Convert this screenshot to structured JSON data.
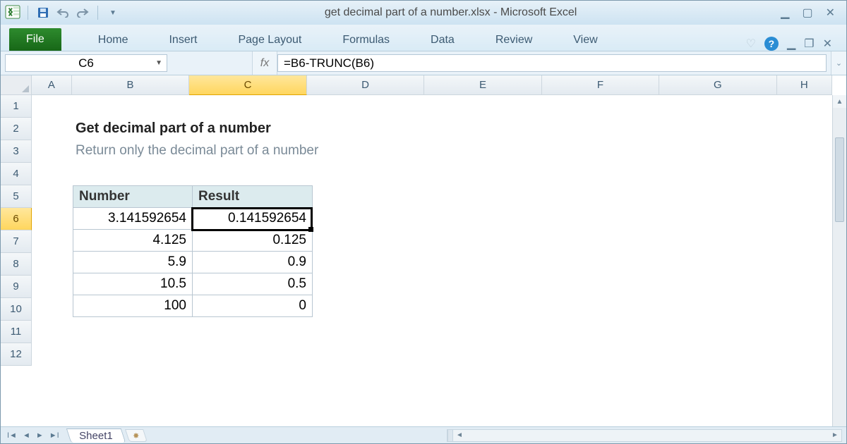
{
  "title": "get decimal part of a number.xlsx  -  Microsoft Excel",
  "ribbon": {
    "file": "File",
    "tabs": [
      "Home",
      "Insert",
      "Page Layout",
      "Formulas",
      "Data",
      "Review",
      "View"
    ]
  },
  "namebox": "C6",
  "fx_symbol": "fx",
  "formula": "=B6-TRUNC(B6)",
  "columns": [
    "A",
    "B",
    "C",
    "D",
    "E",
    "F",
    "G",
    "H"
  ],
  "rows": [
    "1",
    "2",
    "3",
    "4",
    "5",
    "6",
    "7",
    "8",
    "9",
    "10",
    "11",
    "12"
  ],
  "selected_col": "C",
  "selected_row": "6",
  "content": {
    "title": "Get decimal part of a number",
    "subtitle": "Return only the decimal part of a number",
    "headers": {
      "b": "Number",
      "c": "Result"
    },
    "data": [
      {
        "b": "3.141592654",
        "c": "0.141592654"
      },
      {
        "b": "4.125",
        "c": "0.125"
      },
      {
        "b": "5.9",
        "c": "0.9"
      },
      {
        "b": "10.5",
        "c": "0.5"
      },
      {
        "b": "100",
        "c": "0"
      }
    ]
  },
  "sheet_tab": "Sheet1"
}
